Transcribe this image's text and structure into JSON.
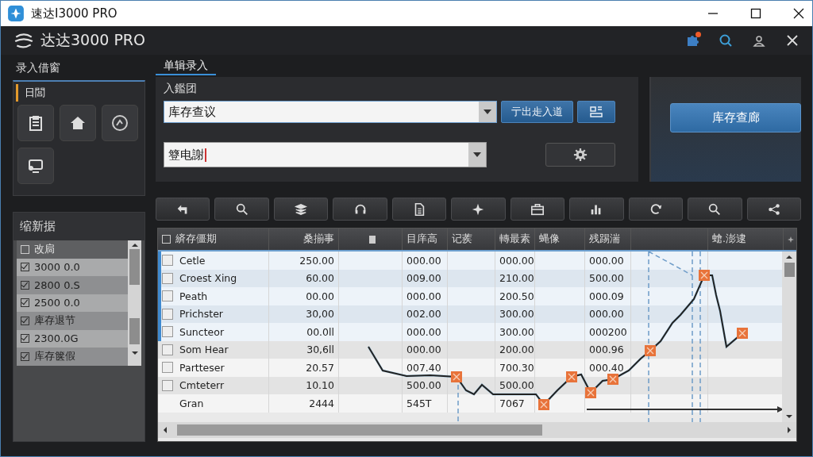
{
  "window": {
    "title": "速达I3000 PRO"
  },
  "app_header": {
    "title": "达达3000 PRO",
    "notification": true
  },
  "left_panel": {
    "title": "录入借窗",
    "tabs": [
      {
        "label": "日閭",
        "selected": true
      }
    ]
  },
  "data_panel": {
    "title": "缩新据",
    "header": {
      "label": "改扃",
      "checked": false
    },
    "items": [
      {
        "label": "3000 0.0",
        "checked": true
      },
      {
        "label": "2800 0.S",
        "checked": true
      },
      {
        "label": "2500 0.0",
        "checked": true
      },
      {
        "label": "庳存退节",
        "checked": true
      },
      {
        "label": "2300.0G",
        "checked": true
      },
      {
        "label": "库存箧假",
        "checked": true
      }
    ]
  },
  "main": {
    "tabs": [
      {
        "label": "单辑录入",
        "selected": true
      }
    ],
    "form_label": "入鑑团",
    "combo_1": {
      "value": "库存查议"
    },
    "action_button": "亍出歨入道",
    "combo_2": {
      "value": "簦电謝"
    },
    "query_button": "库存查廊"
  },
  "table": {
    "header_checked": false,
    "columns": [
      "緕存僵期",
      "桑揃事",
      "目庠高",
      "记蒺",
      "轉最素",
      "蝿像",
      "残踢湍",
      "螥.澎逮"
    ],
    "rows": [
      {
        "kind": "item",
        "checked": false,
        "selected": true,
        "name": "Cetle",
        "column_2": "250.00",
        "column_4": "000.00",
        "column_6": "000.00",
        "column_8": "000.00"
      },
      {
        "kind": "item",
        "checked": false,
        "selected": true,
        "name": "Croest Xing",
        "column_2": "60.00",
        "column_4": "009.00",
        "column_6": "210.00",
        "column_8": "500.00"
      },
      {
        "kind": "item",
        "checked": false,
        "selected": true,
        "name": "Peath",
        "column_2": "00.00",
        "column_4": "000.00",
        "column_6": "200.50",
        "column_8": "000.09"
      },
      {
        "kind": "item",
        "checked": false,
        "selected": true,
        "name": "Prichster",
        "column_2": "30,00",
        "column_4": "002.00",
        "column_6": "300.00",
        "column_8": "000.00"
      },
      {
        "kind": "item",
        "checked": false,
        "selected": true,
        "name": "Suncteor",
        "column_2": "00.0ll",
        "column_4": "000.00",
        "column_6": "300.00",
        "column_8": "000200"
      },
      {
        "kind": "item",
        "checked": false,
        "selected": false,
        "name": "Som Hear",
        "column_2": "30,6ll",
        "column_4": "000.00",
        "column_6": "200.00",
        "column_8": "000.96"
      },
      {
        "kind": "item",
        "checked": false,
        "selected": false,
        "name": "Partteser",
        "column_2": "20.57",
        "column_4": "007.40",
        "column_6": "700.30",
        "column_8": "000.40"
      },
      {
        "kind": "item",
        "checked": false,
        "selected": false,
        "name": "Cmteterr",
        "column_2": "10.10",
        "column_4": "500.00",
        "column_6": "500.00"
      },
      {
        "kind": "total",
        "selected": false,
        "name": "Gran",
        "column_2": "2444",
        "column_4": "545T",
        "column_6": "7067"
      }
    ]
  }
}
